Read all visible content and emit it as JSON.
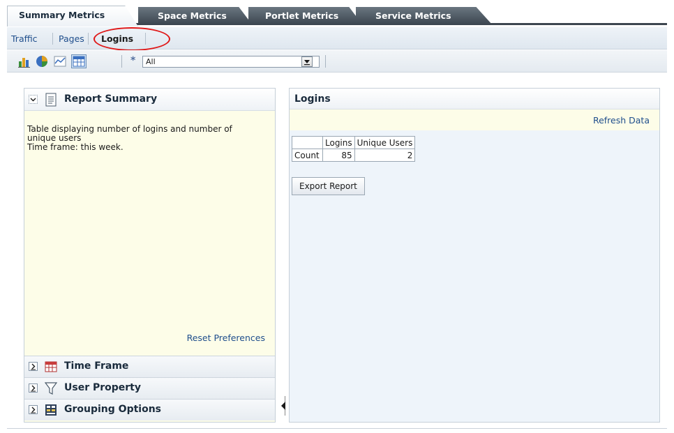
{
  "top_tabs": [
    {
      "label": "Summary Metrics",
      "active": true
    },
    {
      "label": "Space Metrics",
      "active": false
    },
    {
      "label": "Portlet Metrics",
      "active": false
    },
    {
      "label": "Service Metrics",
      "active": false
    }
  ],
  "subnav": [
    {
      "label": "Traffic",
      "active": false
    },
    {
      "label": "Pages",
      "active": false
    },
    {
      "label": "Logins",
      "active": true
    }
  ],
  "toolbar": {
    "icons": [
      "bar-chart-icon",
      "pie-chart-icon",
      "line-chart-icon",
      "table-view-icon"
    ],
    "selected_view": "table-view-icon",
    "asterisk": "*",
    "filter_value": "All"
  },
  "left_panel": {
    "title": "Report Summary",
    "summary_lines": [
      "Table displaying number of logins and number of",
      "unique users",
      "Time frame: this week."
    ],
    "reset_label": "Reset Preferences",
    "sections": [
      {
        "label": "Time Frame",
        "icon": "calendar-icon"
      },
      {
        "label": "User Property",
        "icon": "filter-icon"
      },
      {
        "label": "Grouping Options",
        "icon": "grouping-icon"
      }
    ]
  },
  "right_panel": {
    "title": "Logins",
    "refresh_label": "Refresh Data",
    "table": {
      "headers": [
        "",
        "Logins",
        "Unique Users"
      ],
      "rows": [
        [
          "Count",
          "85",
          "2"
        ]
      ]
    },
    "export_label": "Export Report"
  },
  "colors": {
    "link": "#1f4e8c",
    "highlight": "#e01818",
    "summary_bg": "#fdfde8",
    "tab_dark": "#3a444e"
  }
}
